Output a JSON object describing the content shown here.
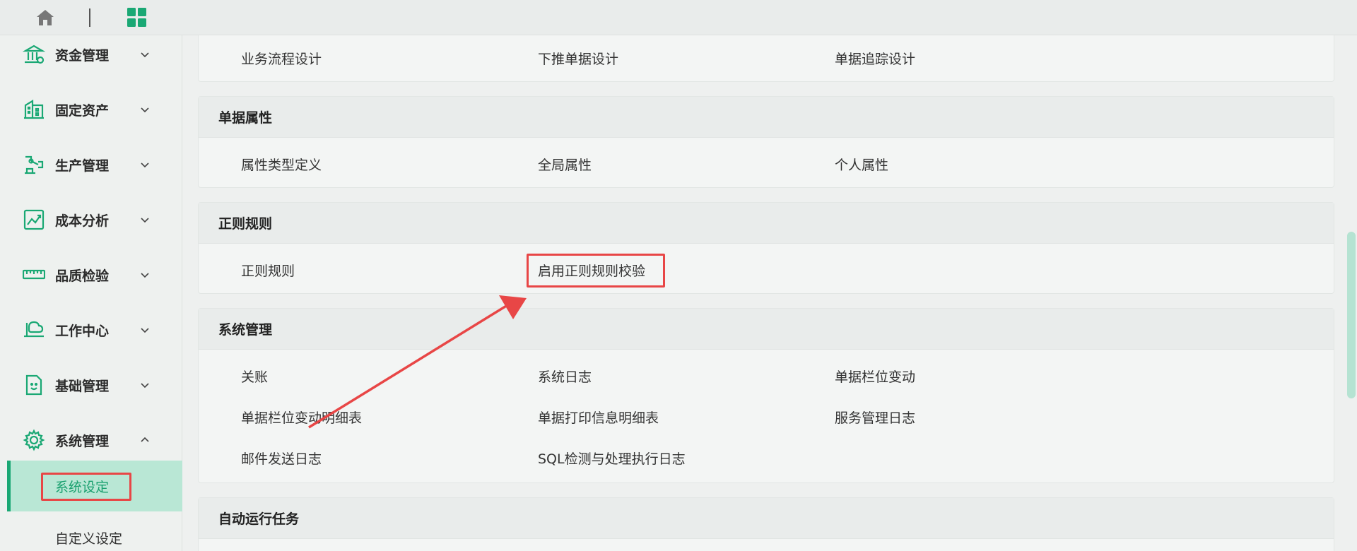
{
  "colors": {
    "accent": "#1aa874",
    "highlight": "#e84646"
  },
  "topbar": {
    "icons": [
      "home-icon",
      "apps-grid-icon"
    ]
  },
  "sidebar": {
    "items": [
      {
        "label": "资金管理",
        "icon": "bank-icon"
      },
      {
        "label": "固定资产",
        "icon": "building-icon"
      },
      {
        "label": "生产管理",
        "icon": "robot-arm-icon"
      },
      {
        "label": "成本分析",
        "icon": "trend-chart-icon"
      },
      {
        "label": "品质检验",
        "icon": "ruler-icon"
      },
      {
        "label": "工作中心",
        "icon": "workstation-icon"
      },
      {
        "label": "基础管理",
        "icon": "document-face-icon"
      },
      {
        "label": "系统管理",
        "icon": "gear-icon",
        "expanded": true
      }
    ],
    "sub_items": [
      {
        "label": "系统设定",
        "active": true
      },
      {
        "label": "自定义设定"
      }
    ]
  },
  "sections": [
    {
      "title": "",
      "links": [
        "业务流程设计",
        "下推单据设计",
        "单据追踪设计"
      ]
    },
    {
      "title": "单据属性",
      "links": [
        "属性类型定义",
        "全局属性",
        "个人属性"
      ]
    },
    {
      "title": "正则规则",
      "links": [
        "正则规则",
        "启用正则规则校验"
      ]
    },
    {
      "title": "系统管理",
      "links": [
        "关账",
        "系统日志",
        "单据栏位变动",
        "单据栏位变动明细表",
        "单据打印信息明细表",
        "服务管理日志",
        "邮件发送日志",
        "SQL检测与处理执行日志"
      ]
    },
    {
      "title": "自动运行任务",
      "links": []
    }
  ]
}
